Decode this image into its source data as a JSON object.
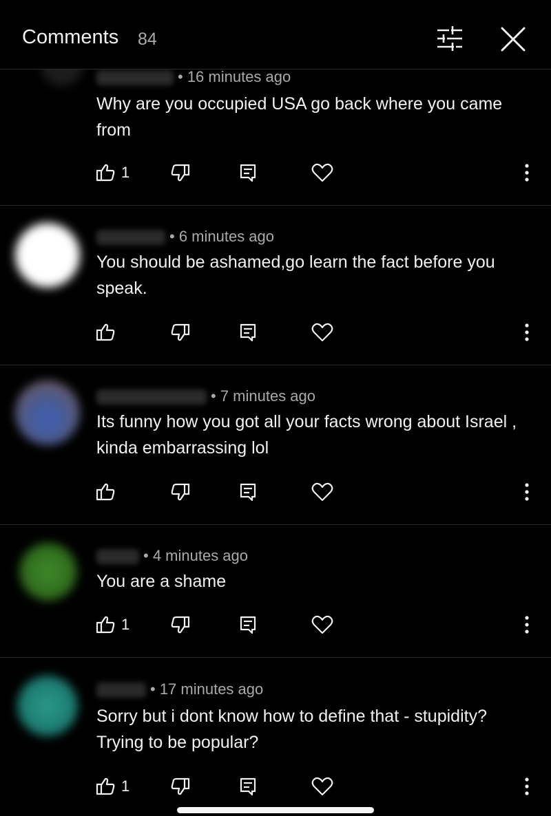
{
  "header": {
    "title": "Comments",
    "count": "84"
  },
  "comments": [
    {
      "time": "• 16 minutes ago",
      "text": "Why are you occupied USA go back where you came from",
      "likes": "1"
    },
    {
      "time": "• 6 minutes ago",
      "text": "You should be ashamed,go learn the fact before you speak.",
      "likes": ""
    },
    {
      "time": "• 7 minutes ago",
      "text": "Its funny how you got all your facts wrong about Israel , kinda embarrassing lol",
      "likes": ""
    },
    {
      "time": "• 4 minutes ago",
      "text": "You are a shame",
      "likes": "1"
    },
    {
      "time": "• 17 minutes ago",
      "text": "Sorry but i dont know how to define that - stupidity? Trying to be popular?",
      "likes": "1"
    }
  ],
  "icons": {
    "filter": "sliders-icon",
    "close": "close-icon",
    "like": "thumbs-up-icon",
    "dislike": "thumbs-down-icon",
    "reply": "reply-icon",
    "heart": "heart-icon",
    "more": "more-vertical-icon"
  },
  "colors": {
    "background": "#000000",
    "text_primary": "#f1f1f1",
    "text_secondary": "#aaaaaa",
    "divider": "#262626"
  }
}
